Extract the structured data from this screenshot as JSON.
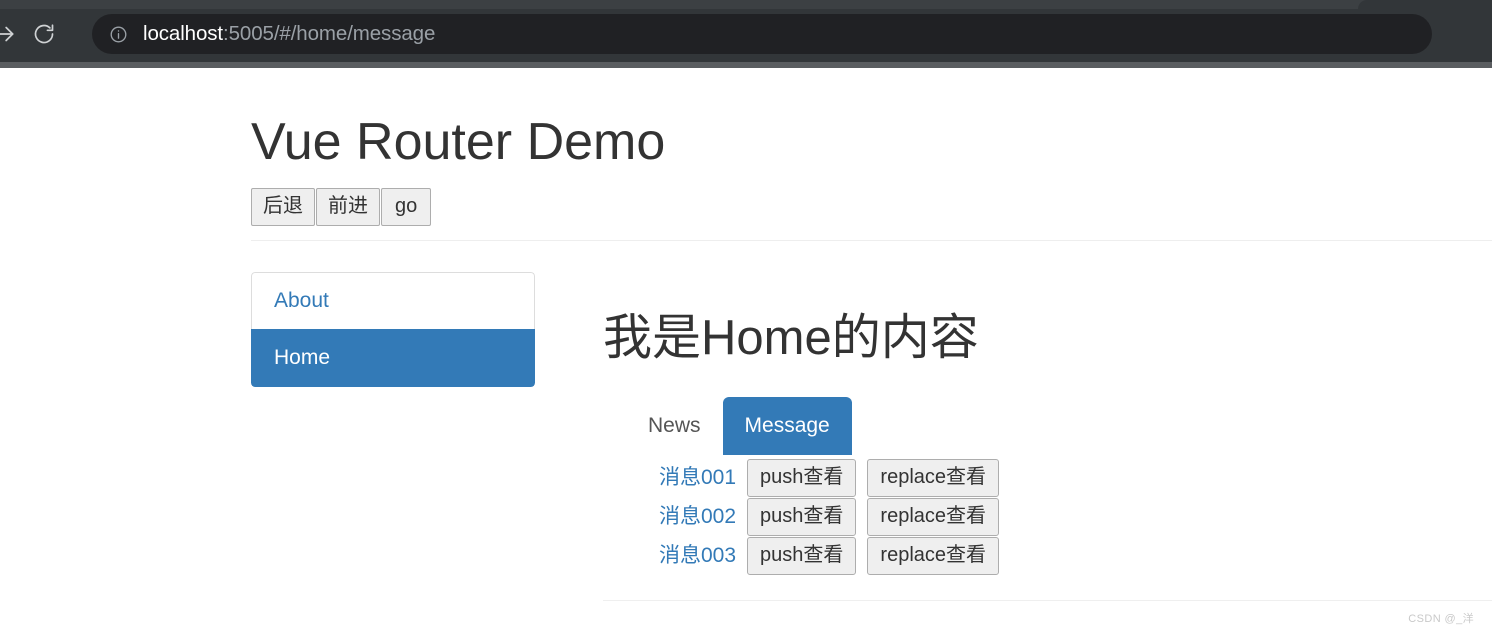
{
  "browser": {
    "forward_icon": "arrow-right-icon",
    "reload_icon": "reload-icon",
    "site_info_icon": "info-circle-icon",
    "url_host": "localhost",
    "url_rest": ":5005/#/home/message"
  },
  "page": {
    "title": "Vue Router Demo",
    "history_buttons": [
      {
        "label": "后退",
        "name": "back-button"
      },
      {
        "label": "前进",
        "name": "forward-button"
      },
      {
        "label": "go",
        "name": "go-button"
      }
    ],
    "sidebar": {
      "items": [
        {
          "label": "About",
          "active": false
        },
        {
          "label": "Home",
          "active": true
        }
      ]
    },
    "content": {
      "heading": "我是Home的内容",
      "tabs": [
        {
          "label": "News",
          "active": false
        },
        {
          "label": "Message",
          "active": true
        }
      ],
      "messages": [
        {
          "link": "消息001",
          "push_label": "push查看",
          "replace_label": "replace查看"
        },
        {
          "link": "消息002",
          "push_label": "push查看",
          "replace_label": "replace查看"
        },
        {
          "link": "消息003",
          "push_label": "push查看",
          "replace_label": "replace查看"
        }
      ]
    },
    "watermark": "CSDN @_洋"
  },
  "colors": {
    "primary": "#337ab7",
    "chrome_toolbar": "#323639",
    "omnibox": "#202124",
    "button_face": "#efefef"
  }
}
